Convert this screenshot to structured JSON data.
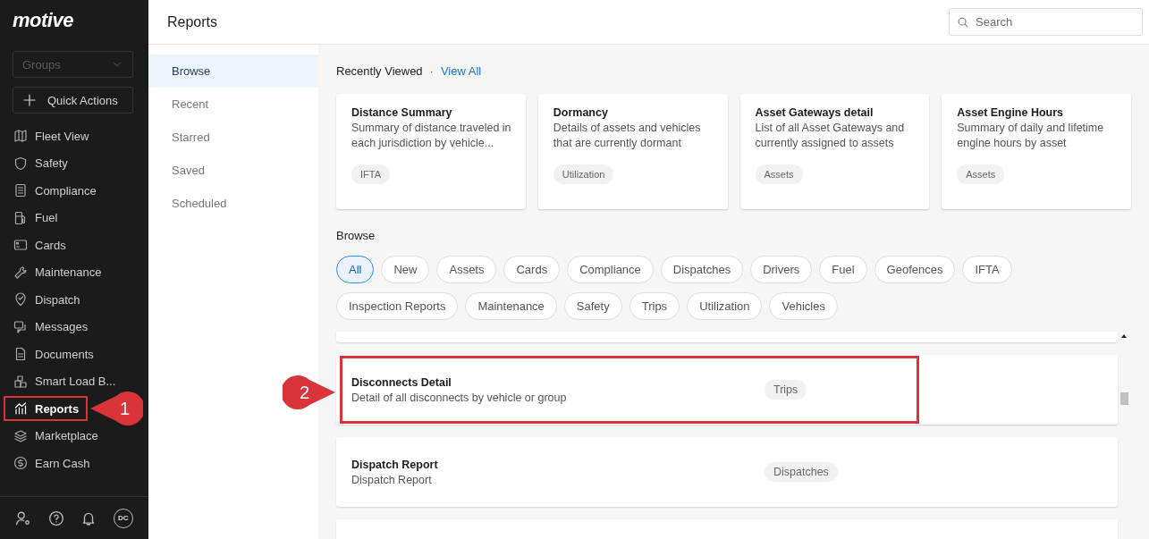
{
  "sidebar": {
    "logo": "motive",
    "groups_dropdown": {
      "placeholder": "Groups"
    },
    "quick_actions": "Quick Actions",
    "nav_items": [
      {
        "label": "Fleet View",
        "selected": false,
        "highlighted": false
      },
      {
        "label": "Safety",
        "selected": false,
        "highlighted": false
      },
      {
        "label": "Compliance",
        "selected": false,
        "highlighted": false
      },
      {
        "label": "Fuel",
        "selected": false,
        "highlighted": false
      },
      {
        "label": "Cards",
        "selected": false,
        "highlighted": false
      },
      {
        "label": "Maintenance",
        "selected": false,
        "highlighted": false
      },
      {
        "label": "Dispatch",
        "selected": false,
        "highlighted": false
      },
      {
        "label": "Messages",
        "selected": false,
        "highlighted": false
      },
      {
        "label": "Documents",
        "selected": false,
        "highlighted": false
      },
      {
        "label": "Smart Load B...",
        "selected": false,
        "highlighted": false
      },
      {
        "label": "Reports",
        "selected": true,
        "highlighted": true,
        "callout": "1"
      },
      {
        "label": "Marketplace",
        "selected": false,
        "highlighted": false
      },
      {
        "label": "Earn Cash",
        "selected": false,
        "highlighted": false
      }
    ],
    "footer": {
      "avatar": "DC"
    }
  },
  "header": {
    "title": "Reports",
    "search": {
      "placeholder": "Search"
    }
  },
  "subnav": [
    {
      "label": "Browse",
      "selected": true
    },
    {
      "label": "Recent",
      "selected": false
    },
    {
      "label": "Starred",
      "selected": false
    },
    {
      "label": "Saved",
      "selected": false
    },
    {
      "label": "Scheduled",
      "selected": false
    }
  ],
  "recently_viewed": {
    "title": "Recently Viewed",
    "separator": "·",
    "link": "View All",
    "cards": [
      {
        "title": "Distance Summary",
        "description": "Summary of distance traveled in each jurisdiction by vehicle...",
        "tag": "IFTA"
      },
      {
        "title": "Dormancy",
        "description": "Details of assets and vehicles that are currently dormant",
        "tag": "Utilization"
      },
      {
        "title": "Asset Gateways detail",
        "description": "List of all Asset Gateways and currently assigned to assets",
        "tag": "Assets"
      },
      {
        "title": "Asset Engine Hours",
        "description": "Summary of daily and lifetime engine hours by asset",
        "tag": "Assets"
      }
    ]
  },
  "browse": {
    "title": "Browse",
    "filters": [
      {
        "label": "All",
        "selected": true
      },
      {
        "label": "New",
        "selected": false
      },
      {
        "label": "Assets",
        "selected": false
      },
      {
        "label": "Cards",
        "selected": false
      },
      {
        "label": "Compliance",
        "selected": false
      },
      {
        "label": "Dispatches",
        "selected": false
      },
      {
        "label": "Drivers",
        "selected": false
      },
      {
        "label": "Fuel",
        "selected": false
      },
      {
        "label": "Geofences",
        "selected": false
      },
      {
        "label": "IFTA",
        "selected": false
      },
      {
        "label": "Inspection Reports",
        "selected": false
      },
      {
        "label": "Maintenance",
        "selected": false
      },
      {
        "label": "Safety",
        "selected": false
      },
      {
        "label": "Trips",
        "selected": false
      },
      {
        "label": "Utilization",
        "selected": false
      },
      {
        "label": "Vehicles",
        "selected": false
      }
    ],
    "reports": [
      {
        "kind": "partial"
      },
      {
        "kind": "report",
        "title": "Disconnects Detail",
        "description": "Detail of all disconnects by vehicle or group",
        "tag": "Trips",
        "highlighted": true,
        "callout": "2"
      },
      {
        "kind": "report",
        "title": "Dispatch Report",
        "description": "Dispatch Report",
        "tag": "Dispatches",
        "highlighted": false
      },
      {
        "kind": "partial"
      }
    ]
  }
}
